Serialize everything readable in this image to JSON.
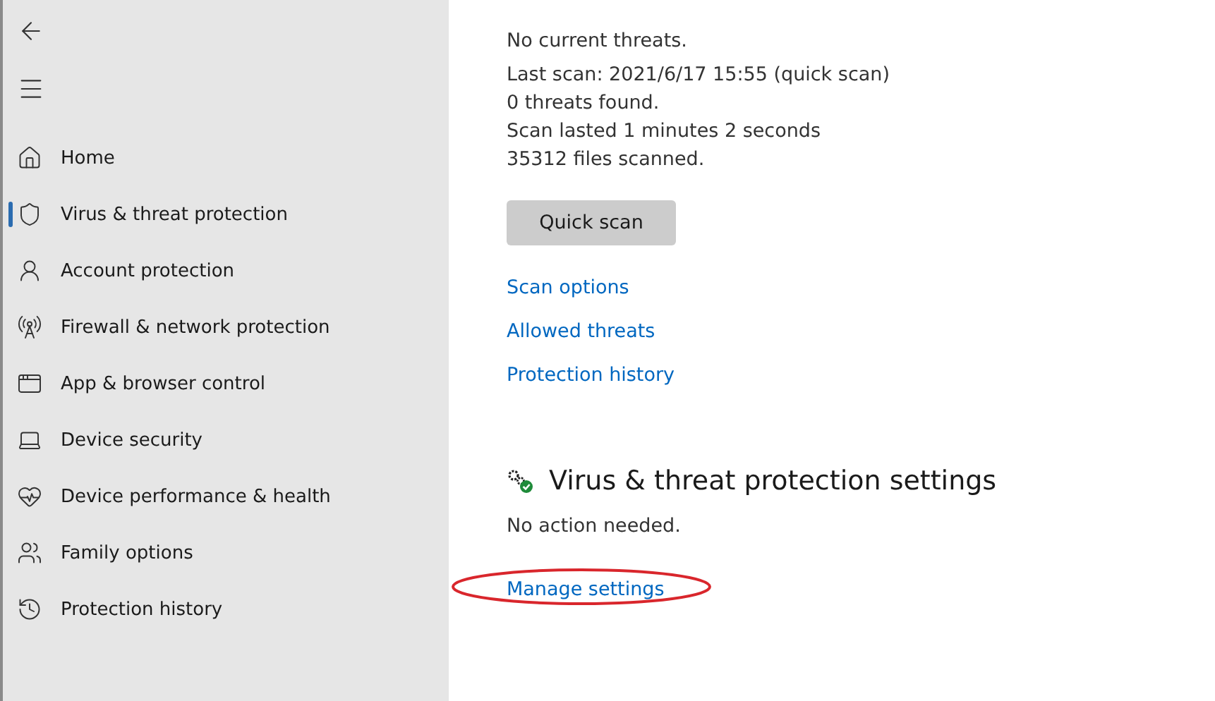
{
  "sidebar": {
    "items": [
      {
        "label": "Home",
        "selected": false
      },
      {
        "label": "Virus & threat protection",
        "selected": true
      },
      {
        "label": "Account protection",
        "selected": false
      },
      {
        "label": "Firewall & network protection",
        "selected": false
      },
      {
        "label": "App & browser control",
        "selected": false
      },
      {
        "label": "Device security",
        "selected": false
      },
      {
        "label": "Device performance & health",
        "selected": false
      },
      {
        "label": "Family options",
        "selected": false
      },
      {
        "label": "Protection history",
        "selected": false
      }
    ]
  },
  "current_threats": {
    "status": "No current threats.",
    "details": [
      "Last scan: 2021/6/17 15:55 (quick scan)",
      "0 threats found.",
      "Scan lasted 1 minutes 2 seconds",
      "35312 files scanned."
    ],
    "button": "Quick scan",
    "links": [
      "Scan options",
      "Allowed threats",
      "Protection history"
    ]
  },
  "settings_section": {
    "title": "Virus & threat protection settings",
    "status": "No action needed.",
    "link": "Manage settings",
    "link_circled": true
  }
}
